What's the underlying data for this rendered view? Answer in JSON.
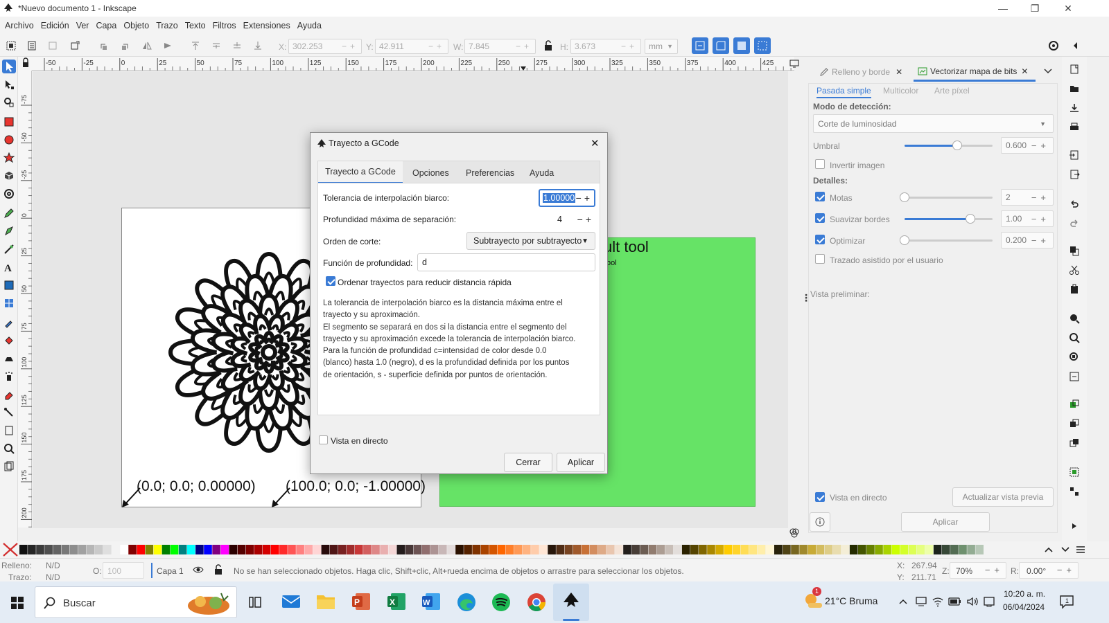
{
  "window": {
    "title": "*Nuevo documento 1 - Inkscape"
  },
  "menu": [
    "Archivo",
    "Edición",
    "Ver",
    "Capa",
    "Objeto",
    "Trazo",
    "Texto",
    "Filtros",
    "Extensiones",
    "Ayuda"
  ],
  "toolbar": {
    "x_label": "X:",
    "x_value": "302.253",
    "y_label": "Y:",
    "y_value": "42.911",
    "w_label": "W:",
    "w_value": "7.845",
    "h_label": "H:",
    "h_value": "3.673",
    "unit": "mm"
  },
  "hruler_labels": [
    "-50",
    "-25",
    "0",
    "25",
    "50",
    "75",
    "100",
    "125",
    "150",
    "175",
    "200",
    "225",
    "250",
    "275",
    "300",
    "325",
    "350",
    "375",
    "400",
    "425"
  ],
  "vruler_labels": [
    "-75",
    "-50",
    "-25",
    "0",
    "25",
    "50",
    "75",
    "100",
    "125",
    "150",
    "175",
    "200"
  ],
  "canvas": {
    "green_title": "ult tool",
    "green_sub": "ool",
    "green_small1": "...",
    "coords_text_1": "(0.0; 0.0; 0.00000)",
    "coords_text_2": "(100.0; 0.0; -1.00000)"
  },
  "dock": {
    "tab1": "Relleno y borde",
    "tab2": "Vectorizar mapa de bits",
    "subtabs": [
      "Pasada simple",
      "Multicolor",
      "Arte píxel"
    ],
    "mode_label": "Modo de detección:",
    "mode_value": "Corte de luminosidad",
    "umbral_label": "Umbral",
    "umbral_value": "0.600",
    "invert_label": "Invertir imagen",
    "details_label": "Detalles:",
    "motas_label": "Motas",
    "motas_value": "2",
    "suavizar_label": "Suavizar bordes",
    "suavizar_value": "1.00",
    "optimizar_label": "Optimizar",
    "optimizar_value": "0.200",
    "trazado_label": "Trazado asistido por el usuario",
    "preview_label": "Vista preliminar:",
    "live_label": "Vista en directo",
    "update_label": "Actualizar vista previa",
    "apply_label": "Aplicar",
    "levels": {
      "umbral": 0.6,
      "motas": 0.0,
      "suavizar": 0.75,
      "optimizar": 0.0
    }
  },
  "dialog": {
    "title": "Trayecto a GCode",
    "tabs": [
      "Trayecto a GCode",
      "Opciones",
      "Preferencias",
      "Ayuda"
    ],
    "tol_label": "Tolerancia de interpolación biarco:",
    "tol_value": "1.00000",
    "depth_label": "Profundidad máxima de separación:",
    "depth_value": "4",
    "order_label": "Orden de corte:",
    "order_value": "Subtrayecto por subtrayecto",
    "func_label": "Función de profundidad:",
    "func_value": "d",
    "sort_label": "Ordenar trayectos para reducir distancia rápida",
    "help_lines": [
      "La tolerancia de interpolación biarco es la distancia máxima entre el",
      "trayecto y su aproximación.",
      "El segmento se separará en dos si la distancia entre el segmento del",
      "trayecto y su aproximación excede la tolerancia de interpolación biarco.",
      "Para la función de profundidad c=intensidad de color desde 0.0",
      "(blanco) hasta 1.0 (negro), d es la profundidad definida por los puntos",
      "de orientación, s - superficie definida por puntos de orientación."
    ],
    "live_label": "Vista en directo",
    "close_label": "Cerrar",
    "apply_label": "Aplicar"
  },
  "status": {
    "fill_label": "Relleno:",
    "fill_value": "N/D",
    "stroke_label": "Trazo:",
    "stroke_value": "N/D",
    "opacity_label": "O:",
    "opacity_value": "100",
    "layer": "Capa 1",
    "message": "No se han seleccionado objetos. Haga clic, Shift+clic, Alt+rueda encima de objetos o arrastre para seleccionar los objetos.",
    "x_label": "X:",
    "x_value": "267.94",
    "y_label": "Y:",
    "y_value": "211.71",
    "zoom_label": "Z:",
    "zoom_value": "70%",
    "rot_label": "R:",
    "rot_value": "0.00°"
  },
  "taskbar": {
    "search": "Buscar",
    "weather": "21°C Bruma",
    "weather_badge": "1",
    "time": "10:20 a. m.",
    "date": "06/04/2024"
  },
  "colors": {
    "accent": "#3a7bd5",
    "green_rect": "#66e366"
  }
}
